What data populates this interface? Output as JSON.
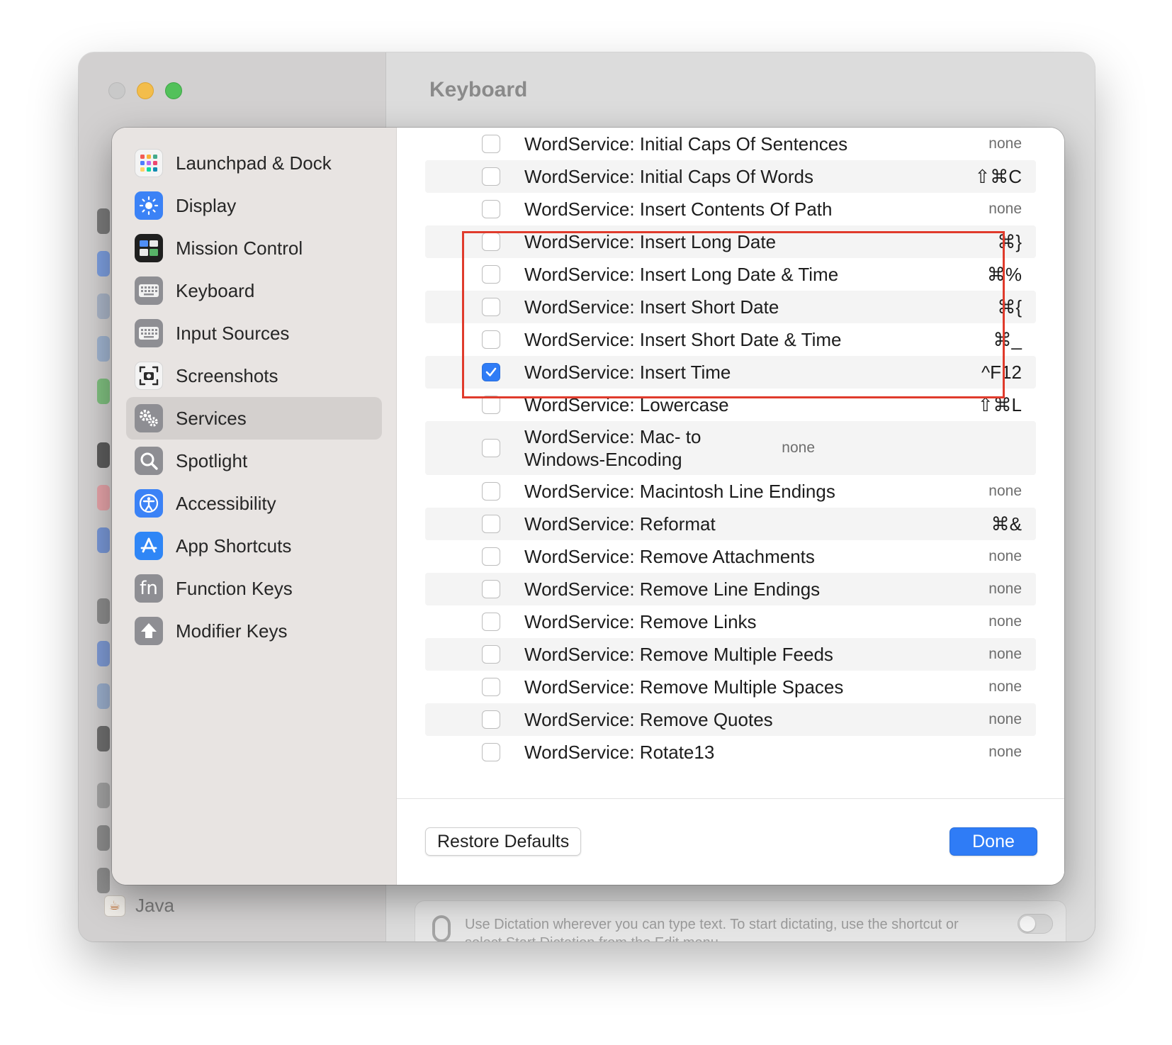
{
  "window": {
    "title": "Keyboard"
  },
  "background": {
    "java_label": "Java",
    "dictation_text": "Use Dictation wherever you can type text. To start dictating, use the shortcut or select Start Dictation from the Edit menu."
  },
  "sidebar": {
    "items": [
      {
        "label": "Launchpad & Dock",
        "icon": "launchpad-icon",
        "selected": false
      },
      {
        "label": "Display",
        "icon": "display-icon",
        "selected": false
      },
      {
        "label": "Mission Control",
        "icon": "mission-control-icon",
        "selected": false
      },
      {
        "label": "Keyboard",
        "icon": "keyboard-icon",
        "selected": false
      },
      {
        "label": "Input Sources",
        "icon": "input-sources-icon",
        "selected": false
      },
      {
        "label": "Screenshots",
        "icon": "screenshots-icon",
        "selected": false
      },
      {
        "label": "Services",
        "icon": "services-gear-icon",
        "selected": true
      },
      {
        "label": "Spotlight",
        "icon": "spotlight-icon",
        "selected": false
      },
      {
        "label": "Accessibility",
        "icon": "accessibility-icon",
        "selected": false
      },
      {
        "label": "App Shortcuts",
        "icon": "app-shortcuts-icon",
        "selected": false
      },
      {
        "label": "Function Keys",
        "icon": "fn-icon",
        "selected": false
      },
      {
        "label": "Modifier Keys",
        "icon": "modifier-keys-icon",
        "selected": false
      }
    ]
  },
  "services": {
    "rows": [
      {
        "label": "WordService: Initial Caps Of Sentences",
        "shortcut": "none",
        "checked": false
      },
      {
        "label": "WordService: Initial Caps Of Words",
        "shortcut": "⇧⌘C",
        "checked": false
      },
      {
        "label": "WordService: Insert Contents Of Path",
        "shortcut": "none",
        "checked": false
      },
      {
        "label": "WordService: Insert Long Date",
        "shortcut": "⌘}",
        "checked": false
      },
      {
        "label": "WordService: Insert Long Date & Time",
        "shortcut": "⌘%",
        "checked": false
      },
      {
        "label": "WordService: Insert Short Date",
        "shortcut": "⌘{",
        "checked": false
      },
      {
        "label": "WordService: Insert Short Date & Time",
        "shortcut": "⌘_",
        "checked": false
      },
      {
        "label": "WordService: Insert Time",
        "shortcut": "^F12",
        "checked": true
      },
      {
        "label": "WordService: Lowercase",
        "shortcut": "⇧⌘L",
        "checked": false
      },
      {
        "label": "WordService: Mac- to Windows-Encoding",
        "shortcut": "none",
        "checked": false,
        "multiline": true
      },
      {
        "label": "WordService: Macintosh Line Endings",
        "shortcut": "none",
        "checked": false
      },
      {
        "label": "WordService: Reformat",
        "shortcut": "⌘&",
        "checked": false
      },
      {
        "label": "WordService: Remove Attachments",
        "shortcut": "none",
        "checked": false
      },
      {
        "label": "WordService: Remove Line Endings",
        "shortcut": "none",
        "checked": false
      },
      {
        "label": "WordService: Remove Links",
        "shortcut": "none",
        "checked": false
      },
      {
        "label": "WordService: Remove Multiple Feeds",
        "shortcut": "none",
        "checked": false
      },
      {
        "label": "WordService: Remove Multiple Spaces",
        "shortcut": "none",
        "checked": false
      },
      {
        "label": "WordService: Remove Quotes",
        "shortcut": "none",
        "checked": false
      },
      {
        "label": "WordService: Rotate13",
        "shortcut": "none",
        "checked": false
      }
    ]
  },
  "footer": {
    "restore_label": "Restore Defaults",
    "done_label": "Done"
  },
  "colors": {
    "accent": "#2f7cf6",
    "highlight_box": "#e03b2c"
  }
}
